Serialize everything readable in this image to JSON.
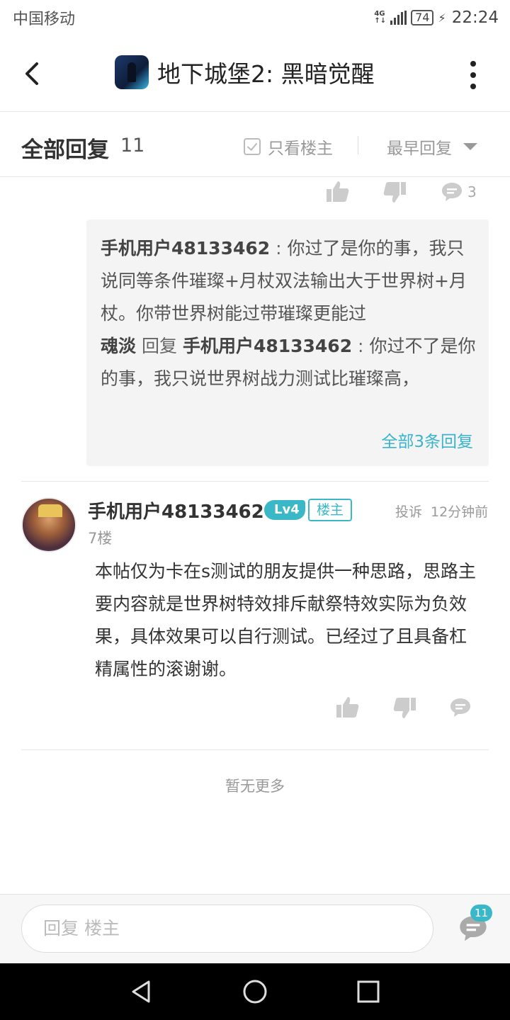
{
  "status_bar": {
    "carrier": "中国移动",
    "network": "4G",
    "battery": "74",
    "time": "22:24"
  },
  "header": {
    "title": "地下城堡2: 黑暗觉醒",
    "app_icon": "game-app-icon",
    "back_icon": "chevron-left-icon",
    "more_icon": "vertical-dots-icon"
  },
  "reply_header": {
    "title": "全部回复",
    "count": "11",
    "op_only_label": "只看楼主",
    "sort_label": "最早回复"
  },
  "prev_post_actions": {
    "comment_count": "3"
  },
  "sub_replies": [
    {
      "user": "手机用户48133462",
      "text": "你过了是你的事，我只说同等条件璀璨+月杖双法输出大于世界树+月杖。你带世界树能过带璀璨更能过"
    },
    {
      "user": "魂淡",
      "verb": "回复",
      "target": "手机用户48133462",
      "text": "你过不了是你的事，我只说世界树战力测试比璀璨高，"
    }
  ],
  "sub_replies_more": "全部3条回复",
  "post": {
    "author": "手机用户48133462",
    "level": "Lv4",
    "op_badge": "楼主",
    "report": "投诉",
    "time": "12分钟前",
    "floor": "7楼",
    "content": "本帖仅为卡在s测试的朋友提供一种思路，思路主要内容就是世界树特效排斥献祭特效实际为负效果，具体效果可以自行测试。已经过了且具备杠精属性的滚谢谢。"
  },
  "footer": {
    "no_more": "暂无更多",
    "reply_placeholder": "回复  楼主",
    "comment_badge": "11"
  },
  "colors": {
    "accent": "#3ab8c8",
    "link": "#3ab4cc"
  }
}
